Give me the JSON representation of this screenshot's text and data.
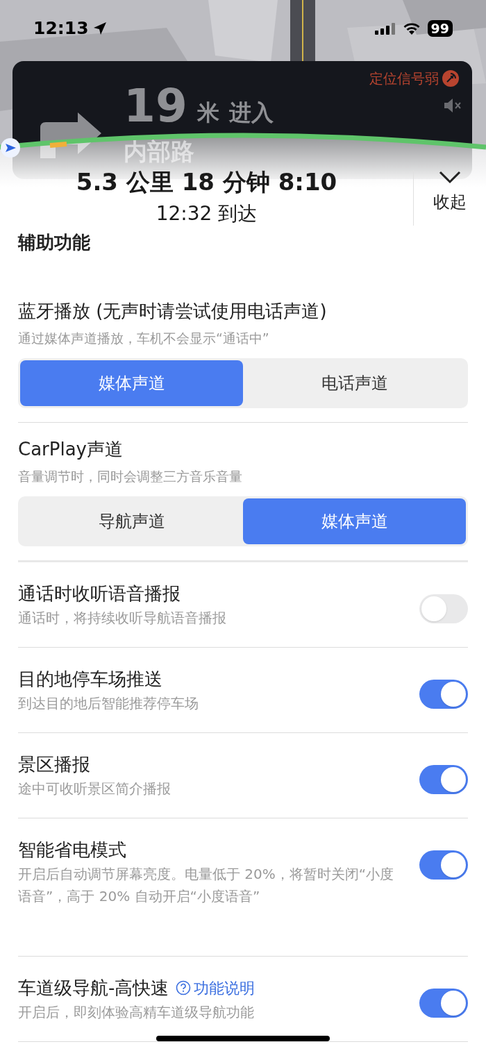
{
  "status_bar": {
    "time": "12:13",
    "battery": "99"
  },
  "guidance": {
    "signal_warning": "定位信号弱",
    "distance": "19",
    "unit": "米",
    "action": "进入",
    "road": "内部路",
    "muted": true
  },
  "trip": {
    "summary": "5.3 公里 18 分钟 8:10",
    "arrival": "12:32 到达",
    "collapse": "收起"
  },
  "section_heading": "辅助功能",
  "settings": [
    {
      "kind": "segment",
      "title": "蓝牙播放 (无声时请尝试使用电话声道)",
      "subtitle": "通过媒体声道播放，车机不会显示“通话中”",
      "options": [
        {
          "label": "媒体声道",
          "selected": true
        },
        {
          "label": "电话声道",
          "selected": false
        }
      ]
    },
    {
      "kind": "segment",
      "title": "CarPlay声道",
      "subtitle": "音量调节时，同时会调整三方音乐音量",
      "options": [
        {
          "label": "导航声道",
          "selected": false
        },
        {
          "label": "媒体声道",
          "selected": true
        }
      ]
    },
    {
      "kind": "toggle",
      "title": "通话时收听语音播报",
      "subtitle": "通话时，将持续收听导航语音播报",
      "on": false
    },
    {
      "kind": "toggle",
      "title": "目的地停车场推送",
      "subtitle": "到达目的地后智能推荐停车场",
      "on": true
    },
    {
      "kind": "toggle",
      "title": "景区播报",
      "subtitle": "途中可收听景区简介播报",
      "on": true
    },
    {
      "kind": "toggle",
      "title": "智能省电模式",
      "subtitle": "开启后自动调节屏幕亮度。电量低于 20%，将暂时关闭“小度语音”，高于 20% 自动开启“小度语音”",
      "on": true
    },
    {
      "kind": "toggle",
      "title": "车道级导航-高快速",
      "link": "功能说明",
      "subtitle": "开启后，即刻体验高精车道级导航功能",
      "on": true
    }
  ]
}
